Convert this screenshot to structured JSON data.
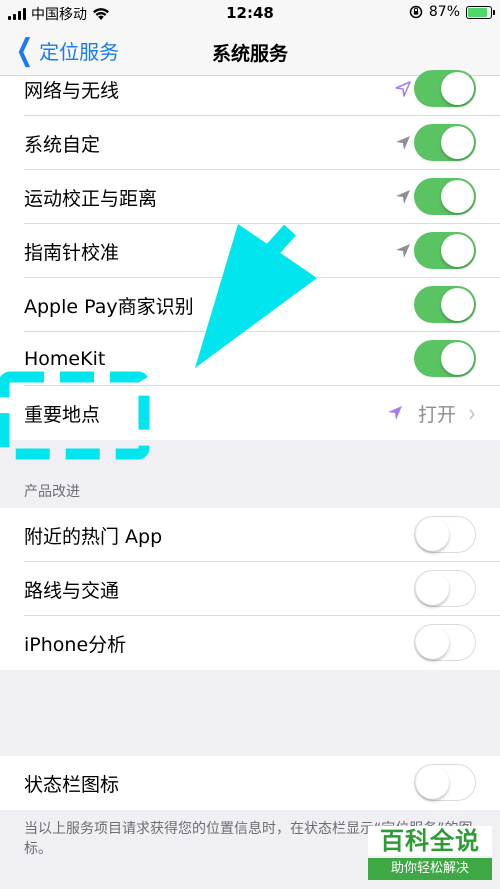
{
  "status_bar": {
    "carrier": "中国移动",
    "time": "12:48",
    "battery_percent": "87%",
    "battery_level": 0.87,
    "icons": [
      "signal-icon",
      "wifi-icon",
      "rotation-lock-icon",
      "battery-charging-icon"
    ]
  },
  "nav": {
    "back_label": "定位服务",
    "title": "系统服务"
  },
  "group1": {
    "rows": [
      {
        "label": "网络与无线",
        "icon": "location-arrow-purple",
        "toggle": "on"
      },
      {
        "label": "系统自定",
        "icon": "location-arrow-gray",
        "toggle": "on"
      },
      {
        "label": "运动校正与距离",
        "icon": "location-arrow-gray",
        "toggle": "on"
      },
      {
        "label": "指南针校准",
        "icon": "location-arrow-gray",
        "toggle": "on"
      },
      {
        "label": "Apple Pay商家识别",
        "toggle": "on"
      },
      {
        "label": "HomeKit",
        "toggle": "on"
      },
      {
        "label": "重要地点",
        "icon": "location-arrow-purple",
        "value": "打开"
      }
    ]
  },
  "product_section": {
    "header": "产品改进",
    "rows": [
      {
        "label": "附近的热门 App",
        "toggle": "off"
      },
      {
        "label": "路线与交通",
        "toggle": "off"
      },
      {
        "label": "iPhone分析",
        "toggle": "off"
      }
    ]
  },
  "status_icon_section": {
    "row": {
      "label": "状态栏图标",
      "toggle": "off"
    },
    "footer": "当以上服务项目请求获得您的位置信息时，在状态栏显示“定位服务”的图标。"
  },
  "watermark": {
    "title": "百科全说",
    "subtitle": "助你轻松解决"
  },
  "colors": {
    "accent": "#1a7bf0",
    "toggle_on": "#5ac463",
    "annotation": "#00e5ee",
    "location_purple": "#a77bf0"
  }
}
